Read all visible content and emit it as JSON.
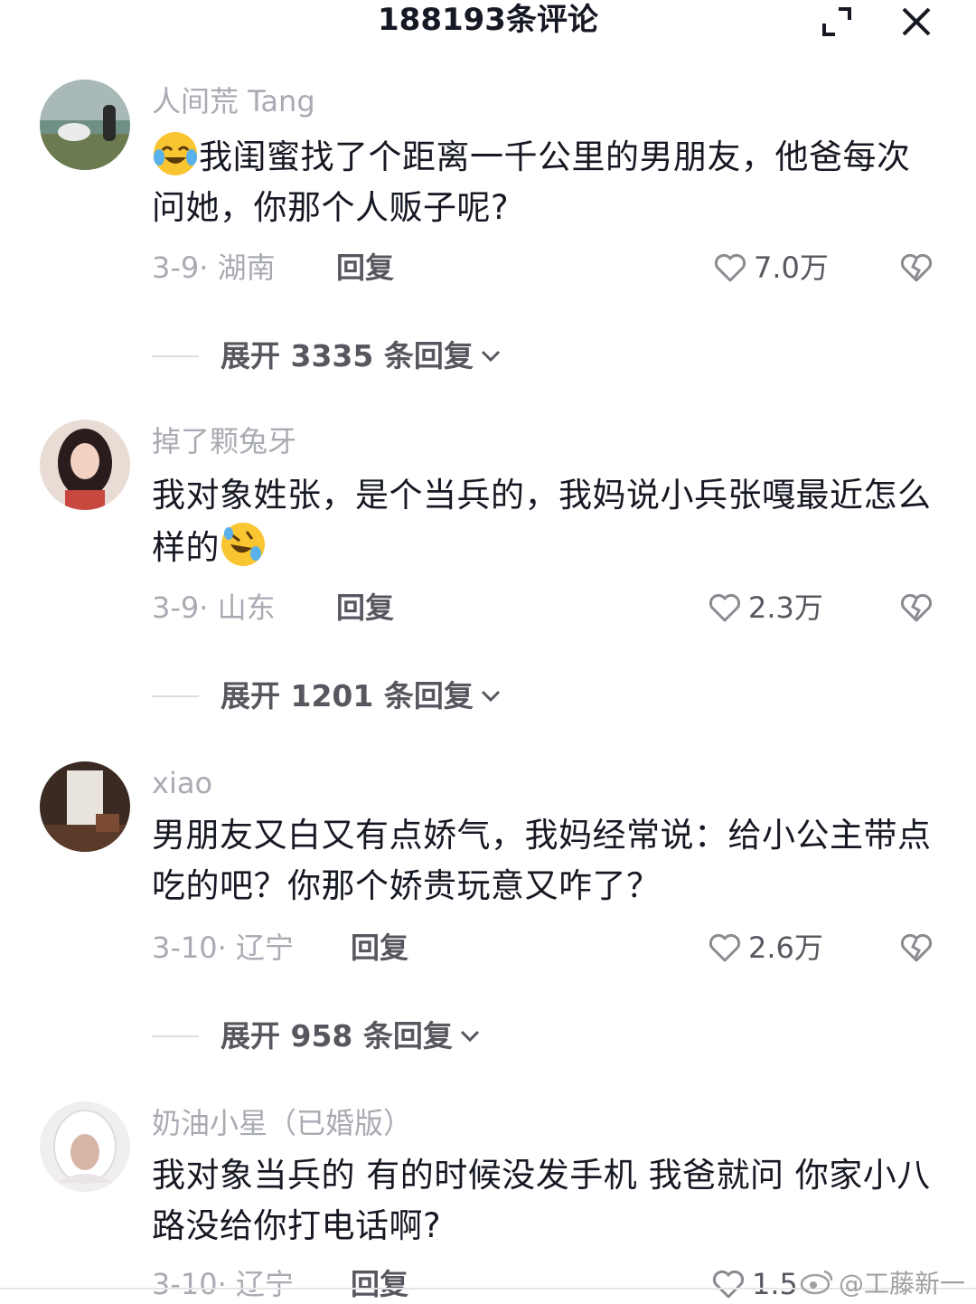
{
  "header": {
    "title": "188193条评论",
    "expand_icon": "expand-icon",
    "close_icon": "close-icon"
  },
  "comments": [
    {
      "username": "人间荒 Tang",
      "text": "我闺蜜找了个距离一千公里的男朋友，他爸每次问她，你那个人贩子呢?",
      "leading_emoji": "crying-laughing-emoji",
      "date_location": "3-9· 湖南",
      "reply_label": "回复",
      "likes": "7.0万",
      "expand_label": "展开 3335 条回复"
    },
    {
      "username": "掉了颗兔牙",
      "text": "我对象姓张，是个当兵的，我妈说小兵张嘎最近怎么样的",
      "trailing_emoji": "rolling-laughing-emoji",
      "date_location": "3-9· 山东",
      "reply_label": "回复",
      "likes": "2.3万",
      "expand_label": "展开 1201 条回复"
    },
    {
      "username": "xiao",
      "text": "男朋友又白又有点娇气，我妈经常说：给小公主带点吃的吧？你那个娇贵玩意又咋了？",
      "date_location": "3-10· 辽宁",
      "reply_label": "回复",
      "likes": "2.6万",
      "expand_label": "展开 958 条回复"
    },
    {
      "username": "奶油小星（已婚版）",
      "text": "我对象当兵的 有的时候没发手机 我爸就问 你家小八路没给你打电话啊?",
      "date_location": "3-10· 辽宁",
      "reply_label": "回复",
      "likes": "1.5"
    }
  ],
  "watermark": "@工藤新一",
  "colors": {
    "primary_text": "#161823",
    "secondary_text": "#a9abb3",
    "action_text": "#57585f"
  }
}
